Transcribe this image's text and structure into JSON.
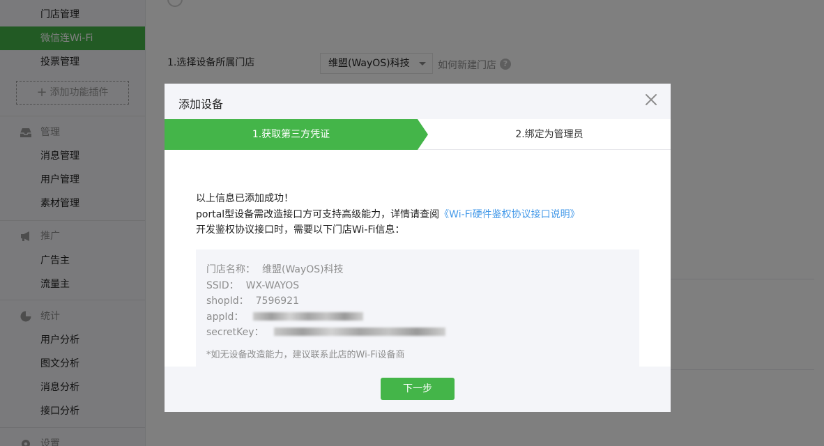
{
  "sidebar": {
    "items_top": [
      {
        "label": "门店管理"
      },
      {
        "label": "微信连Wi-Fi"
      },
      {
        "label": "投票管理"
      }
    ],
    "add_plugin_label": "添加功能插件",
    "groups": {
      "manage": {
        "title": "管理",
        "icon": "inbox-icon",
        "items": [
          {
            "label": "消息管理"
          },
          {
            "label": "用户管理"
          },
          {
            "label": "素材管理"
          }
        ]
      },
      "promote": {
        "title": "推广",
        "icon": "megaphone-icon",
        "items": [
          {
            "label": "广告主"
          },
          {
            "label": "流量主"
          }
        ]
      },
      "stats": {
        "title": "统计",
        "icon": "pie-chart-icon",
        "items": [
          {
            "label": "用户分析"
          },
          {
            "label": "图文分析"
          },
          {
            "label": "消息分析"
          },
          {
            "label": "接口分析"
          }
        ]
      },
      "settings": {
        "title": "设置",
        "icon": "gear-icon"
      }
    }
  },
  "main": {
    "field_label": "1.选择设备所属门店",
    "store_select": {
      "value": "维盟(WayOS)科技"
    },
    "new_store_link": "如何新建门店",
    "help_icon_glyph": "?"
  },
  "dialog": {
    "title": "添加设备",
    "close_glyph": "×",
    "steps": [
      {
        "label": "1.获取第三方凭证",
        "active": true
      },
      {
        "label": "2.绑定为管理员",
        "active": false
      }
    ],
    "success_text": "以上信息已添加成功！",
    "portal_text": "portal型设备需改造接口方可支持高级能力，详情请查阅",
    "doc_link": "《Wi-Fi硬件鉴权协议接口说明》",
    "dev_text": "开发鉴权协议接口时，需要以下门店Wi-Fi信息：",
    "info": {
      "store_name_label": "门店名称：",
      "store_name_value": "维盟(WayOS)科技",
      "ssid_label": "SSID：",
      "ssid_value": "WX-WAYOS",
      "shopid_label": "shopId：",
      "shopid_value": "7596921",
      "appid_label": "appId：",
      "secretkey_label": "secretKey："
    },
    "note": "*如无设备改造能力，建议联系此店的Wi-Fi设备商",
    "next_button": "下一步"
  },
  "colors": {
    "brand_green": "#44b549",
    "link_blue": "#459ae9",
    "panel_gray": "#f4f5f9"
  }
}
